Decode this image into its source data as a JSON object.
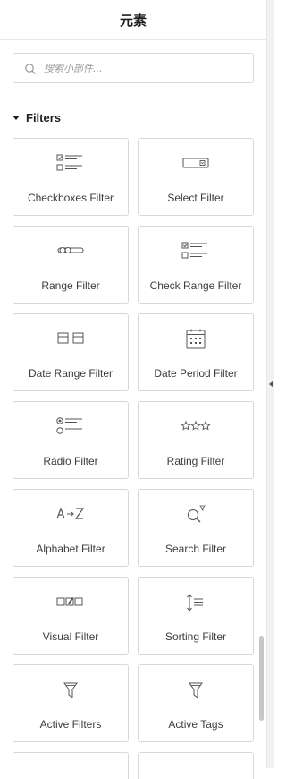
{
  "header": {
    "title": "元素"
  },
  "search": {
    "placeholder": "搜索小部件..."
  },
  "section": {
    "title": "Filters"
  },
  "widgets": [
    {
      "label": "Checkboxes Filter",
      "icon": "checkbox-list-icon"
    },
    {
      "label": "Select Filter",
      "icon": "select-dropdown-icon"
    },
    {
      "label": "Range Filter",
      "icon": "range-slider-icon"
    },
    {
      "label": "Check Range Filter",
      "icon": "check-range-icon"
    },
    {
      "label": "Date Range Filter",
      "icon": "date-range-icon"
    },
    {
      "label": "Date Period Filter",
      "icon": "calendar-icon"
    },
    {
      "label": "Radio Filter",
      "icon": "radio-list-icon"
    },
    {
      "label": "Rating Filter",
      "icon": "stars-icon"
    },
    {
      "label": "Alphabet Filter",
      "icon": "alphabet-icon"
    },
    {
      "label": "Search Filter",
      "icon": "search-filter-icon"
    },
    {
      "label": "Visual Filter",
      "icon": "visual-swatches-icon"
    },
    {
      "label": "Sorting Filter",
      "icon": "sorting-icon"
    },
    {
      "label": "Active Filters",
      "icon": "funnel-icon"
    },
    {
      "label": "Active Tags",
      "icon": "funnel-icon"
    }
  ]
}
